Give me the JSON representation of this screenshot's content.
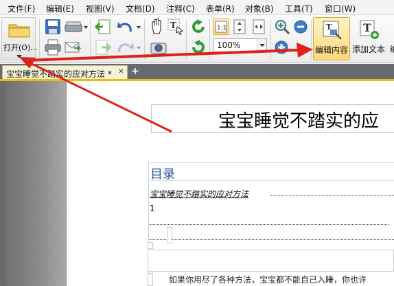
{
  "menubar": {
    "items": [
      "文件(F)",
      "编辑(E)",
      "视图(V)",
      "文档(D)",
      "注释(C)",
      "表单(R)",
      "对象(B)",
      "工具(T)",
      "窗口(W)"
    ]
  },
  "toolbar": {
    "open_label": "打开(O)...",
    "zoom_value": "100%",
    "edit_content_label": "编辑内容",
    "add_text_label": "添加文本",
    "truncated_label": "编"
  },
  "tabs": [
    {
      "title": "宝宝睡觉不踏实的应对方法 *",
      "close": "×"
    }
  ],
  "new_tab_symbol": "+",
  "document": {
    "title": "宝宝睡觉不踏实的应",
    "toc_heading": "目录",
    "toc_entry": "宝宝睡觉不踏实的应对方法",
    "toc_page": "1",
    "body_text": "如果你用尽了各种方法，宝宝都不能自己入睡，你也许"
  },
  "colors": {
    "accent_tab_line": "#f6b800",
    "highlight_button": "#ffd97a",
    "toc_heading": "#2b579a",
    "annotation_arrow": "#e0201a"
  }
}
